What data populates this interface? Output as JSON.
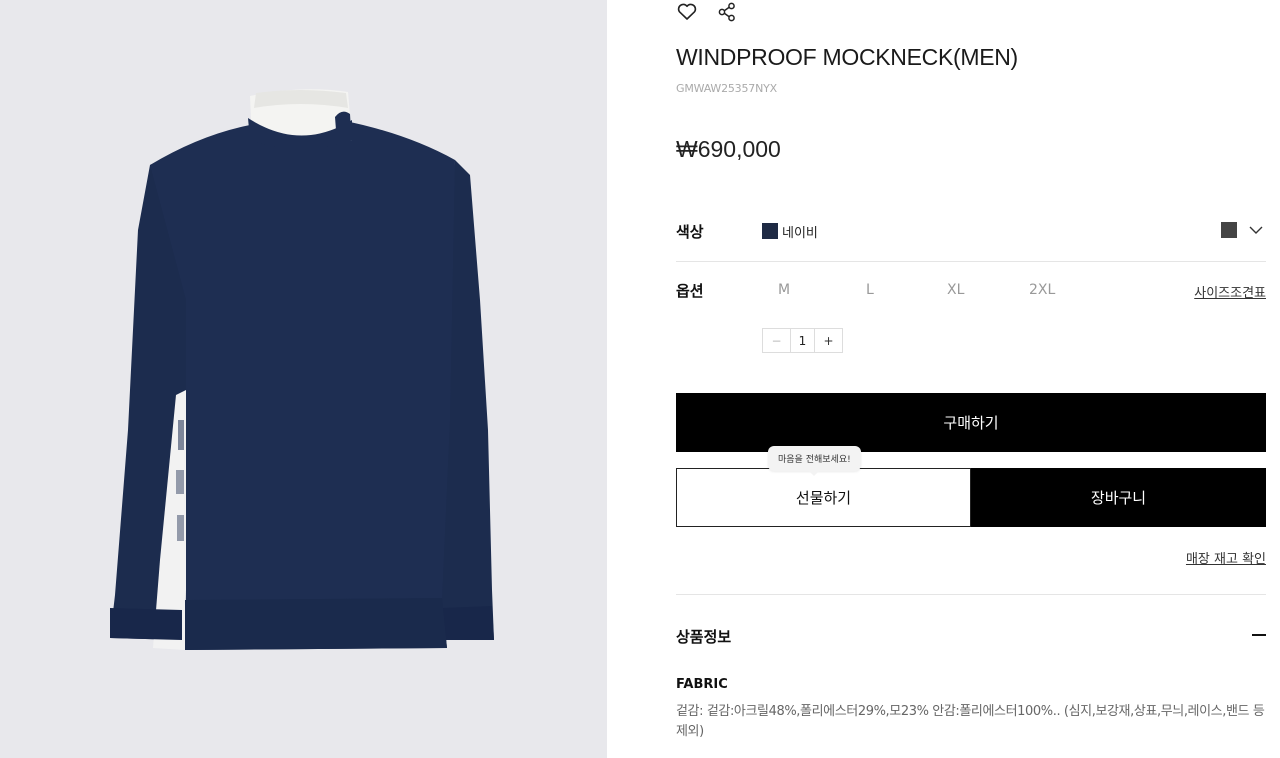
{
  "product": {
    "name": "WINDPROOF MOCKNECK(MEN)",
    "sku": "GMWAW25357NYX",
    "price": "₩690,000"
  },
  "actions": {
    "wishlist_icon": "heart-icon",
    "share_icon": "share-icon"
  },
  "color": {
    "label": "색상",
    "selected": "네이비",
    "swatch": "#1e2a44"
  },
  "option": {
    "label": "옵션",
    "sizes": [
      "M",
      "L",
      "XL",
      "2XL"
    ],
    "size_chart": "사이즈조견표"
  },
  "quantity": {
    "minus": "−",
    "value": "1",
    "plus": "+"
  },
  "buttons": {
    "buy": "구매하기",
    "gift": "선물하기",
    "gift_tooltip": "마음을 전해보세요!",
    "cart": "장바구니",
    "store_stock": "매장 재고 확인"
  },
  "info": {
    "title": "상품정보",
    "fabric_label": "FABRIC",
    "fabric_desc": "겉감: 겉감:아크릴48%,폴리에스터29%,모23% 안감:폴리에스터100%.. (심지,보강재,상표,무늬,레이스,밴드 등 제외)"
  }
}
